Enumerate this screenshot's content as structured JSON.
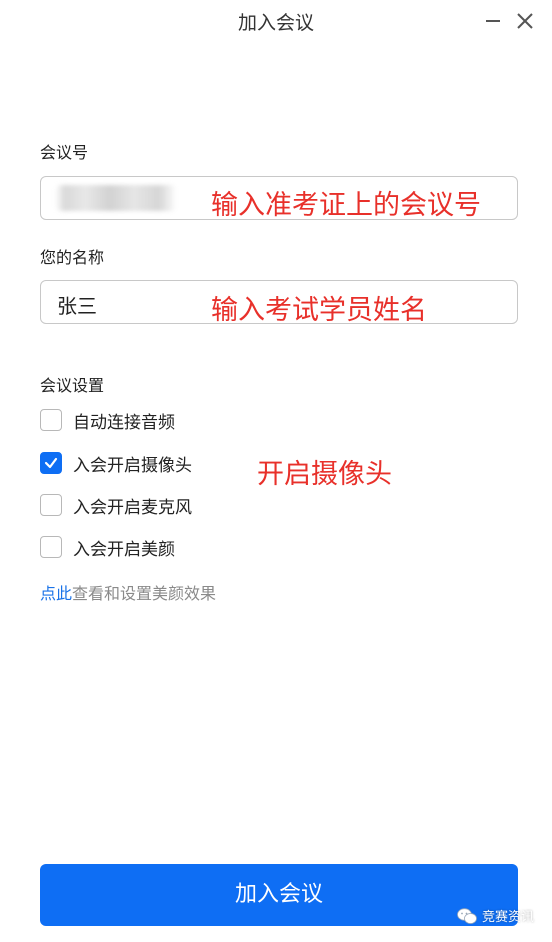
{
  "window": {
    "title": "加入会议"
  },
  "meeting_id": {
    "label": "会议号",
    "annotation": "输入准考证上的会议号"
  },
  "name": {
    "label": "您的名称",
    "value": "张三",
    "annotation": "输入考试学员姓名"
  },
  "settings": {
    "label": "会议设置",
    "options": [
      {
        "label": "自动连接音频",
        "checked": false
      },
      {
        "label": "入会开启摄像头",
        "checked": true
      },
      {
        "label": "入会开启麦克风",
        "checked": false
      },
      {
        "label": "入会开启美颜",
        "checked": false
      }
    ],
    "camera_annotation": "开启摄像头"
  },
  "beauty": {
    "link": "点此",
    "text": "查看和设置美颜效果"
  },
  "join_button": "加入会议",
  "watermark": {
    "text": "竞赛资讯"
  },
  "colors": {
    "primary": "#0e6ef4",
    "annotation": "#e8302a",
    "link": "#1a73e8"
  }
}
